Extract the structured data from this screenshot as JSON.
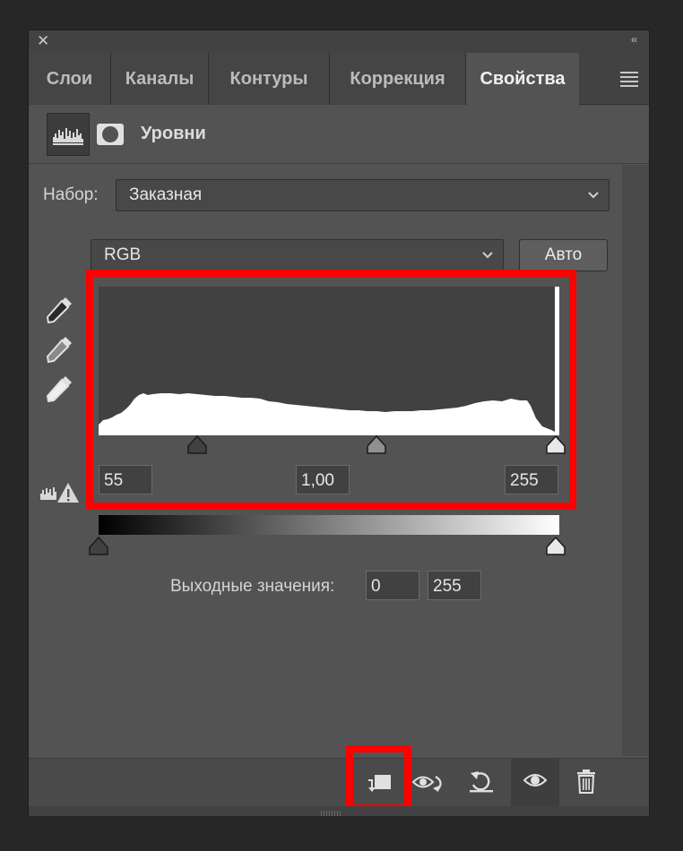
{
  "window": {
    "close_glyph": "✕",
    "collapse_glyph": "‹‹"
  },
  "tabs": [
    {
      "label": "Слои"
    },
    {
      "label": "Каналы"
    },
    {
      "label": "Контуры"
    },
    {
      "label": "Коррекция"
    },
    {
      "label": "Свойства",
      "active": true
    }
  ],
  "header": {
    "title": "Уровни",
    "icons": [
      "levels-histogram-icon",
      "layer-mask-icon"
    ]
  },
  "preset": {
    "label": "Набор:",
    "value": "Заказная"
  },
  "channel": {
    "value": "RGB"
  },
  "auto_button": {
    "label": "Авто"
  },
  "eyedroppers": [
    "black-point-eyedropper-icon",
    "gray-point-eyedropper-icon",
    "white-point-eyedropper-icon"
  ],
  "input_levels": {
    "black": "55",
    "gamma": "1,00",
    "white": "255"
  },
  "output_levels": {
    "label": "Выходные значения:",
    "black": "0",
    "white": "255"
  },
  "footer_icons": [
    "clip-to-layer-icon",
    "view-previous-state-icon",
    "reset-icon",
    "visibility-eye-icon",
    "trash-icon"
  ],
  "highlight_color": "#ff0000"
}
